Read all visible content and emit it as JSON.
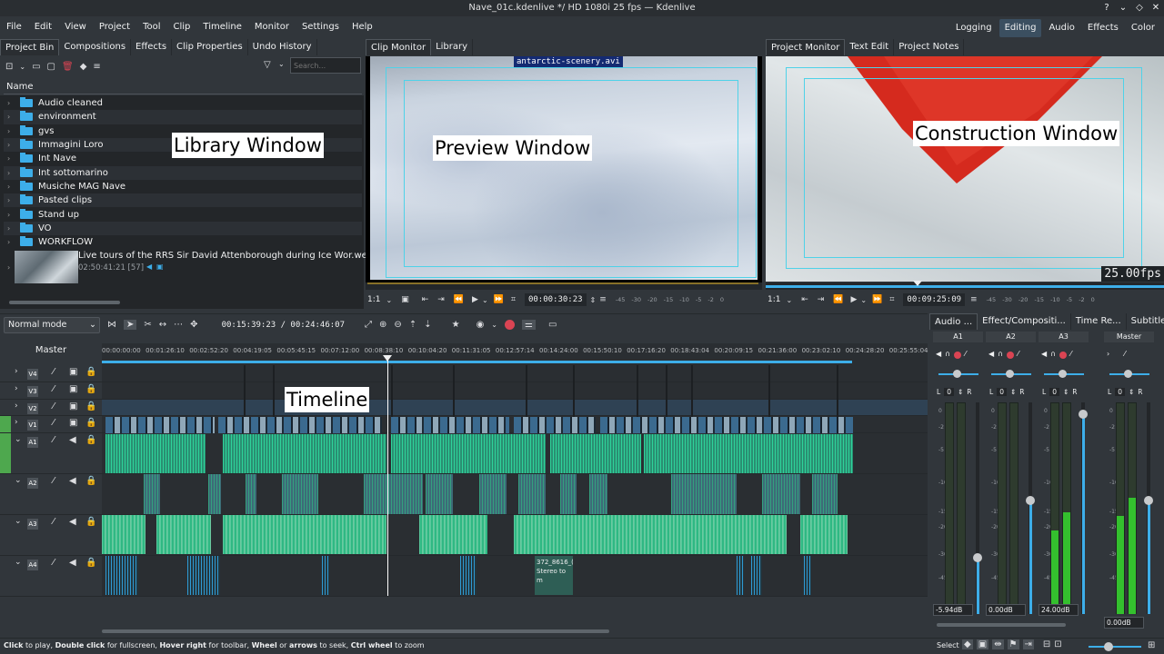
{
  "window": {
    "title": "Nave_01c.kdenlive */ HD 1080i 25 fps — Kdenlive"
  },
  "menu": [
    "File",
    "Edit",
    "View",
    "Project",
    "Tool",
    "Clip",
    "Timeline",
    "Monitor",
    "Settings",
    "Help"
  ],
  "layouts": [
    "Logging",
    "Editing",
    "Audio",
    "Effects",
    "Color"
  ],
  "bin": {
    "tabs": [
      "Project Bin",
      "Compositions",
      "Effects",
      "Clip Properties",
      "Undo History"
    ],
    "search_placeholder": "Search...",
    "column": "Name",
    "folders": [
      "Audio cleaned",
      "environment",
      "gvs",
      "Immagini Loro",
      "Int Nave",
      "Int sottomarino",
      "Musiche MAG Nave",
      "Pasted clips",
      "Stand up",
      "VO",
      "WORKFLOW"
    ],
    "clip": {
      "name": "Live tours of the RRS Sir David Attenborough during Ice Wor.webm",
      "meta": "02:50:41:21 [57]"
    }
  },
  "clip_monitor": {
    "tabs": [
      "Clip Monitor",
      "Library"
    ],
    "clip_name": "antarctic-scenery.avi",
    "zoom": "1:1",
    "timecode": "00:00:30:23",
    "scale": [
      "-45",
      "-30",
      "-20",
      "-15",
      "-10",
      "-5",
      "-2",
      "0"
    ]
  },
  "project_monitor": {
    "tabs": [
      "Project Monitor",
      "Text Edit",
      "Project Notes"
    ],
    "fps": "25.00fps",
    "zoom": "1:1",
    "timecode": "00:09:25:09",
    "scale": [
      "-45",
      "-30",
      "-20",
      "-15",
      "-10",
      "-5",
      "-2",
      "0"
    ]
  },
  "annotations": {
    "library": "Library Window",
    "preview": "Preview Window",
    "construction": "Construction Window",
    "timeline": "Timeline"
  },
  "timeline": {
    "mode": "Normal mode",
    "position": "00:15:39:23 / 00:24:46:07",
    "master": "Master",
    "ruler": [
      "00:00:00:00",
      "00:01:26:10",
      "00:02:52:20",
      "00:04:19:05",
      "00:05:45:15",
      "00:07:12:00",
      "00:08:38:10",
      "00:10:04:20",
      "00:11:31:05",
      "00:12:57:14",
      "00:14:24:00",
      "00:15:50:10",
      "00:17:16:20",
      "00:18:43:04",
      "00:20:09:15",
      "00:21:36:00",
      "00:23:02:10",
      "00:24:28:20",
      "00:25:55:04"
    ],
    "tracks": [
      "V4",
      "V3",
      "V2",
      "V1",
      "A1",
      "A2",
      "A3",
      "A4"
    ],
    "clip_label_1": "372_8616_(",
    "clip_label_2": "Stereo to m"
  },
  "mixer": {
    "tabs": [
      "Audio ...",
      "Effect/Compositi...",
      "Time Re...",
      "Subtitles"
    ],
    "channels": [
      {
        "name": "A1",
        "db": "-5.94dB"
      },
      {
        "name": "A2",
        "db": "0.00dB"
      },
      {
        "name": "A3",
        "db": "24.00dB"
      },
      {
        "name": "Master",
        "db": "0.00dB"
      }
    ],
    "scale": [
      "0",
      "-2",
      "-5",
      "-10",
      "-15",
      "-20",
      "-30",
      "-45"
    ],
    "pan": {
      "left": "L",
      "value": "0",
      "right": "R"
    }
  },
  "status": {
    "hint_parts": [
      {
        "b": true,
        "t": "Click"
      },
      {
        "b": false,
        "t": " to play, "
      },
      {
        "b": true,
        "t": "Double click"
      },
      {
        "b": false,
        "t": " for fullscreen, "
      },
      {
        "b": true,
        "t": "Hover right"
      },
      {
        "b": false,
        "t": " for toolbar, "
      },
      {
        "b": true,
        "t": "Wheel"
      },
      {
        "b": false,
        "t": " or "
      },
      {
        "b": true,
        "t": "arrows"
      },
      {
        "b": false,
        "t": " to seek, "
      },
      {
        "b": true,
        "t": "Ctrl wheel"
      },
      {
        "b": false,
        "t": " to zoom"
      }
    ],
    "select": "Select"
  },
  "colors": {
    "accent": "#3daee9",
    "video_clip": "#3b6a8f",
    "audio_clip": "#3fa58a",
    "wave": "#2ed39a",
    "record": "#da4453",
    "meter": "#34c02e"
  }
}
